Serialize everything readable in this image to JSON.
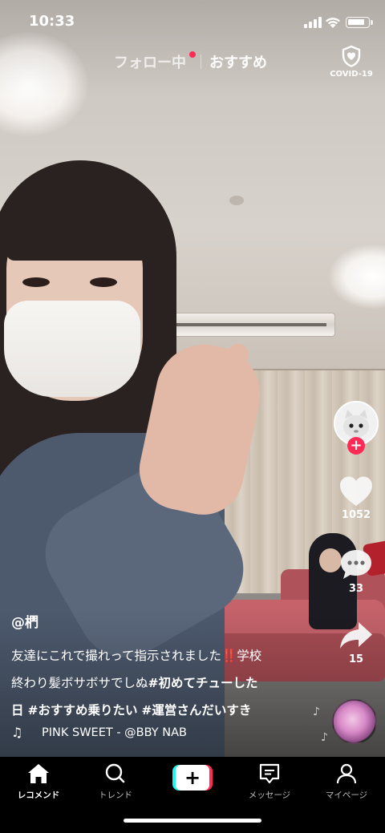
{
  "status_bar": {
    "time": "10:33",
    "battery_level": 0.85
  },
  "feed_tabs": {
    "following_label": "フォロー中",
    "for_you_label": "おすすめ",
    "active": "for_you",
    "following_has_new": true
  },
  "covid": {
    "label": "COVID-19",
    "icon": "shield-heart-icon"
  },
  "actions": {
    "like_count": "1052",
    "comment_count": "33",
    "share_count": "15",
    "follow_icon": "plus-icon",
    "like_icon": "heart-icon",
    "comment_icon": "comment-bubble-icon",
    "share_icon": "share-arrow-icon"
  },
  "video": {
    "author": "@椚",
    "desc_line1_text": "友達にこれで撮れって指示されました",
    "desc_line1_emoji": "‼️",
    "desc_line1_end": "学校",
    "desc_line2_text": "終わり髪ボサボサでしぬ",
    "desc_line2_tag": "#初めてチューした",
    "desc_line3_tag_cont": "日",
    "desc_line3_tag2": "#おすすめ乗りたい",
    "desc_line3_tag3": "#運営さんだいすき",
    "music": "PINK SWEET - @BBY NAB"
  },
  "bottom_nav": {
    "items": [
      {
        "label": "レコメンド",
        "icon": "home-icon",
        "active": true
      },
      {
        "label": "トレンド",
        "icon": "search-icon",
        "active": false
      },
      {
        "label": "",
        "icon": "create-plus-icon",
        "active": false
      },
      {
        "label": "メッセージ",
        "icon": "message-icon",
        "active": false
      },
      {
        "label": "マイページ",
        "icon": "profile-icon",
        "active": false
      }
    ]
  },
  "colors": {
    "accent_red": "#fe2c55",
    "accent_cyan": "#25f4ee"
  }
}
